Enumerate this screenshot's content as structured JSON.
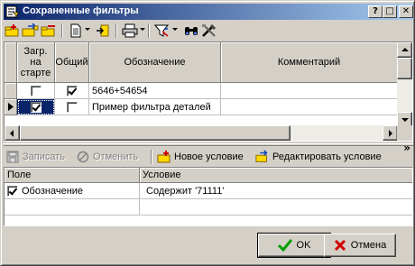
{
  "window": {
    "title": "Сохраненные фильтры"
  },
  "title_buttons": {
    "help": "?",
    "restore": "□",
    "close": "✕"
  },
  "toolbar_icons": [
    "add-filter-icon",
    "copy-filter-icon",
    "delete-filter-icon",
    "document-icon",
    "dropdown-arrow-icon",
    "export-icon",
    "print-icon",
    "dropdown-arrow-icon",
    "filter-icon",
    "dropdown-arrow-icon",
    "binoculars-icon",
    "tools-icon"
  ],
  "filters_grid": {
    "columns": [
      "Загр. на старте",
      "Общий",
      "Обозначение",
      "Комментарий"
    ],
    "rows": [
      {
        "load_on_start": false,
        "shared": true,
        "name": "5646+54654",
        "comment": "",
        "current": false
      },
      {
        "load_on_start": true,
        "shared": false,
        "name": "Пример фильтра деталей",
        "comment": "",
        "current": true
      }
    ]
  },
  "splitter": {
    "arrows": "»"
  },
  "conditions_toolbar": {
    "save": "Записать",
    "cancel": "Отменить",
    "new_condition": "Новое условие",
    "edit_condition": "Редактировать условие"
  },
  "conditions_grid": {
    "columns": [
      "Поле",
      "Условие"
    ],
    "rows": [
      {
        "checked": true,
        "field": "Обозначение",
        "condition": "Содержит '71111'"
      }
    ]
  },
  "buttons": {
    "ok": "OK",
    "cancel": "Отмена"
  },
  "colors": {
    "title_start": "#0a246a",
    "title_end": "#a6caf0",
    "face": "#d4d0c8",
    "selection": "#0a246a"
  }
}
